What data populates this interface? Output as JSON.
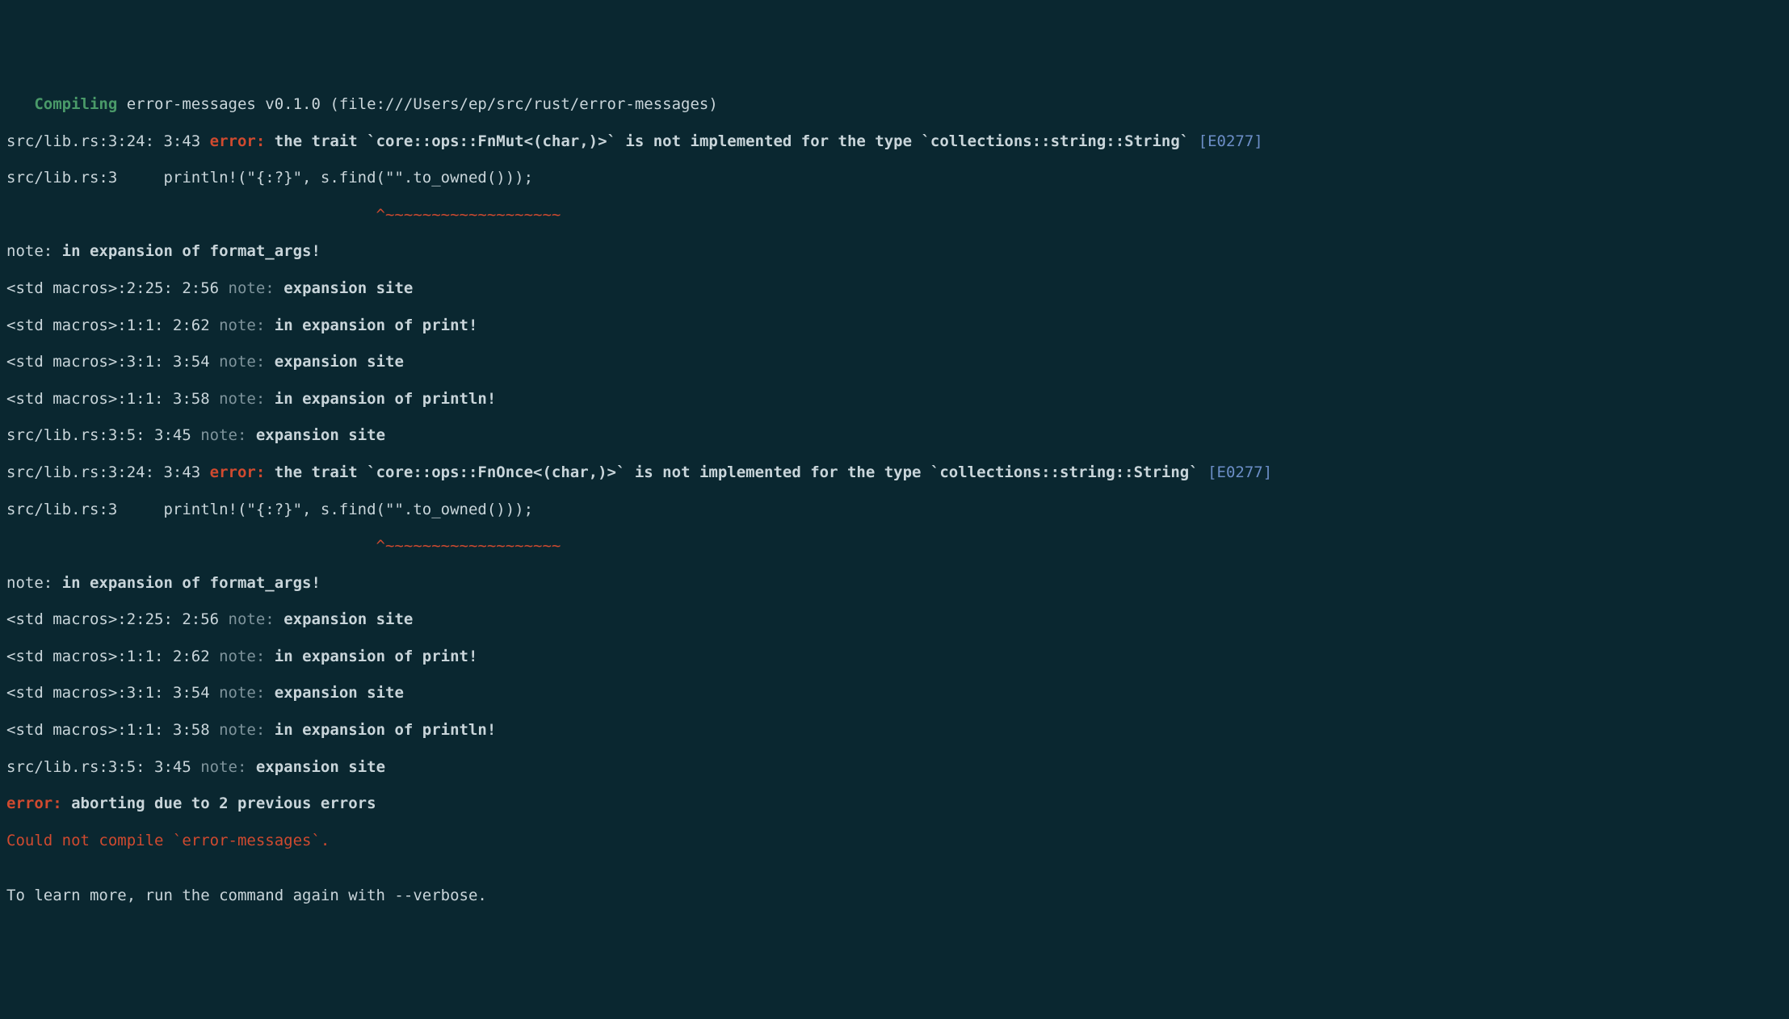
{
  "compile": {
    "word": "Compiling",
    "rest": " error-messages v0.1.0 (file:///Users/ep/src/rust/error-messages)"
  },
  "err1": {
    "loc": "src/lib.rs:3:24: 3:43 ",
    "label": "error: ",
    "msg1": "the trait `core::ops::FnMut<(char,)>` is not implemented for the type `collections::string::String`",
    "ecode": "[E0277]",
    "srcline": "src/lib.rs:3     println!(\"{:?}\", s.find(\"\".to_owned()));",
    "caret": "                                        ^~~~~~~~~~~~~~~~~~~~"
  },
  "noteA": {
    "prefix": "note: ",
    "txt": "in expansion of format_args!"
  },
  "m1": {
    "loc": "<std macros>:2:25: 2:56 ",
    "nlabel": "note: ",
    "txt": "expansion site"
  },
  "m2": {
    "loc": "<std macros>:1:1: 2:62 ",
    "nlabel": "note: ",
    "txt": "in expansion of print!"
  },
  "m3": {
    "loc": "<std macros>:3:1: 3:54 ",
    "nlabel": "note: ",
    "txt": "expansion site"
  },
  "m4": {
    "loc": "<std macros>:1:1: 3:58 ",
    "nlabel": "note: ",
    "txt": "in expansion of println!"
  },
  "m5": {
    "loc": "src/lib.rs:3:5: 3:45 ",
    "nlabel": "note: ",
    "txt": "expansion site"
  },
  "err2": {
    "loc": "src/lib.rs:3:24: 3:43 ",
    "label": "error: ",
    "msg1": "the trait `core::ops::FnOnce<(char,)>` is not implemented for the type `collections::string::String`",
    "ecode": "[E0277]",
    "srcline": "src/lib.rs:3     println!(\"{:?}\", s.find(\"\".to_owned()));",
    "caret": "                                        ^~~~~~~~~~~~~~~~~~~~"
  },
  "noteB": {
    "prefix": "note: ",
    "txt": "in expansion of format_args!"
  },
  "n1": {
    "loc": "<std macros>:2:25: 2:56 ",
    "nlabel": "note: ",
    "txt": "expansion site"
  },
  "n2": {
    "loc": "<std macros>:1:1: 2:62 ",
    "nlabel": "note: ",
    "txt": "in expansion of print!"
  },
  "n3": {
    "loc": "<std macros>:3:1: 3:54 ",
    "nlabel": "note: ",
    "txt": "expansion site"
  },
  "n4": {
    "loc": "<std macros>:1:1: 3:58 ",
    "nlabel": "note: ",
    "txt": "in expansion of println!"
  },
  "n5": {
    "loc": "src/lib.rs:3:5: 3:45 ",
    "nlabel": "note: ",
    "txt": "expansion site"
  },
  "abort": {
    "label": "error: ",
    "msg": "aborting due to 2 previous errors"
  },
  "fail": "Could not compile `error-messages`.",
  "blank": "",
  "learn": "To learn more, run the command again with --verbose."
}
